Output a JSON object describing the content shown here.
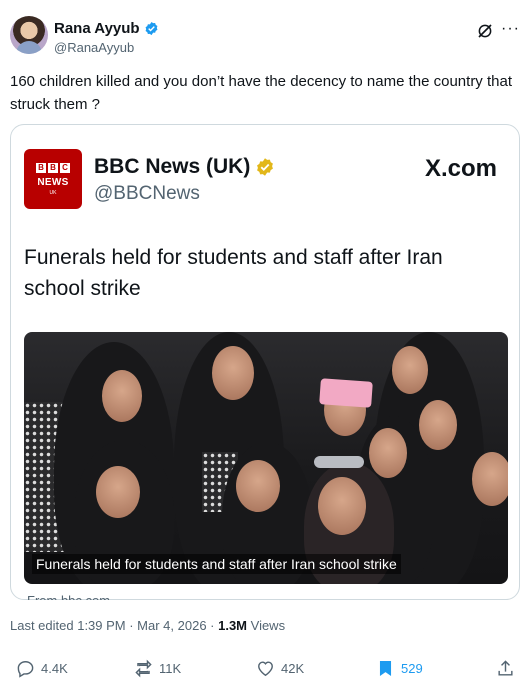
{
  "author": {
    "name": "Rana Ayyub",
    "handle": "@RanaAyyub"
  },
  "tweet_text": "160 children killed and you don’t have the decency to name the country that struck them ?",
  "card": {
    "source_name": "BBC News (UK)",
    "source_handle": "@BBCNews",
    "site": "X.com",
    "logo": {
      "letters": [
        "B",
        "B",
        "C"
      ],
      "word": "NEWS",
      "sub": "UK"
    },
    "headline": "Funerals held for students and staff after Iran school strike",
    "image_caption": "Funerals held for students and staff after Iran school strike",
    "from_text": "From bbc.com"
  },
  "meta": {
    "edited_prefix": "Last edited 1:39 PM · Mar 4, 2026 · ",
    "views_count": "1.3M",
    "views_label": " Views"
  },
  "actions": {
    "replies": "4.4K",
    "reposts": "11K",
    "likes": "42K",
    "bookmarks": "529"
  },
  "colors": {
    "verified_blue": "#1d9bf0",
    "gold_badge": "#e2b719",
    "bbc_red": "#b80000",
    "muted_text": "#536471"
  },
  "icons": [
    "verified-icon",
    "grok-icon",
    "more-icon",
    "gold-verified-icon",
    "reply-icon",
    "repost-icon",
    "like-icon",
    "bookmark-icon",
    "share-icon"
  ]
}
